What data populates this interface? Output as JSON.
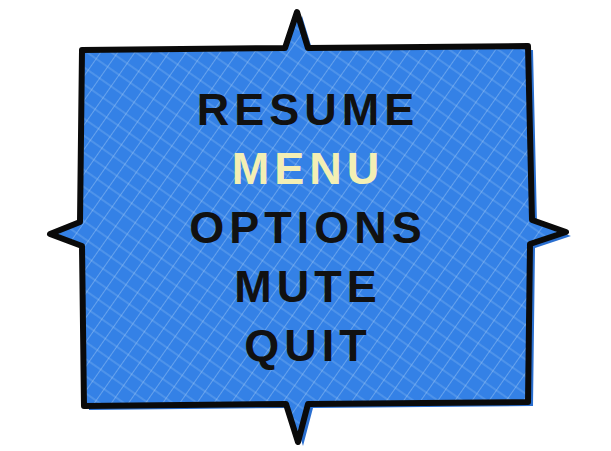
{
  "menu": {
    "items": [
      {
        "label": "RESUME",
        "selected": false
      },
      {
        "label": "MENU",
        "selected": true
      },
      {
        "label": "OPTIONS",
        "selected": false
      },
      {
        "label": "MUTE",
        "selected": false
      },
      {
        "label": "QUIT",
        "selected": false
      }
    ]
  }
}
